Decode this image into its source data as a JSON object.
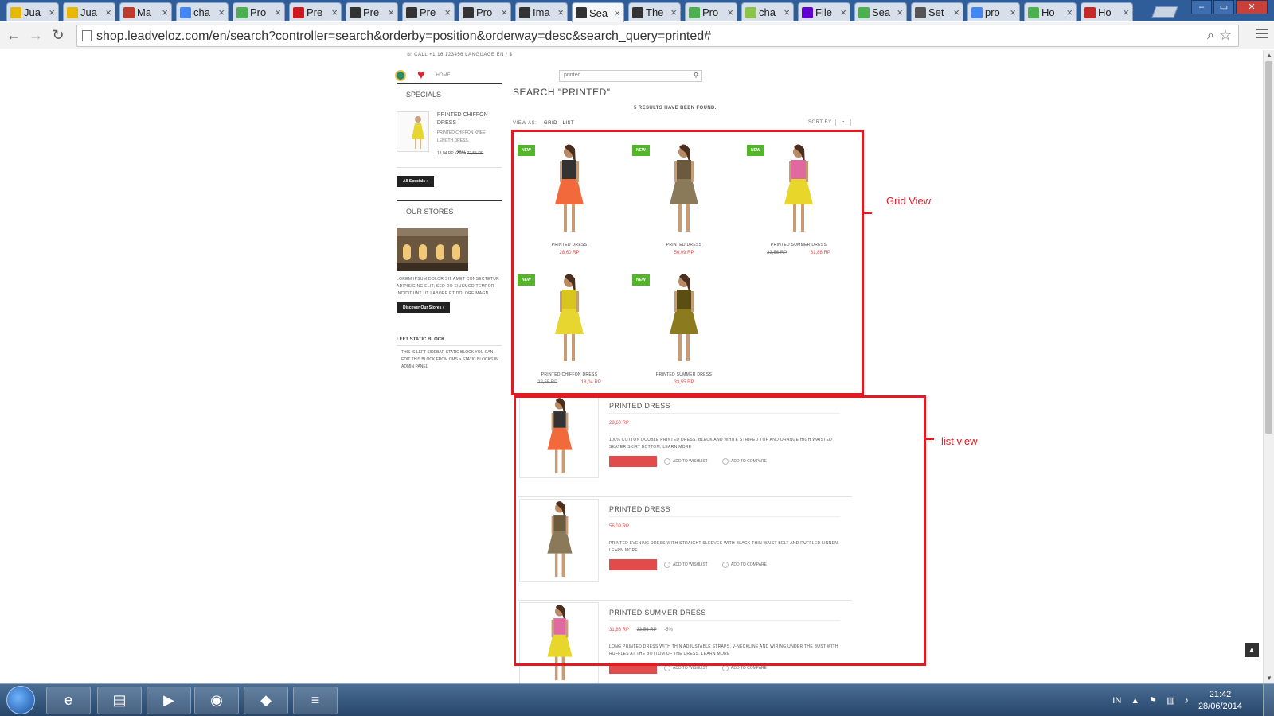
{
  "browser": {
    "tabs": [
      {
        "label": "Jua",
        "icon": "gmail-icon",
        "color": "#e8b800"
      },
      {
        "label": "Jua",
        "icon": "gmail-icon",
        "color": "#e8b800"
      },
      {
        "label": "Ma",
        "icon": "bars-icon",
        "color": "#c0392b"
      },
      {
        "label": "cha",
        "icon": "google-icon",
        "color": "#4285f4"
      },
      {
        "label": "Pro",
        "icon": "leaf-icon",
        "color": "#4caf50"
      },
      {
        "label": "Pre",
        "icon": "youtube-icon",
        "color": "#cc181e"
      },
      {
        "label": "Pre",
        "icon": "prestashop-icon",
        "color": "#333333"
      },
      {
        "label": "Pre",
        "icon": "prestashop-icon",
        "color": "#333333"
      },
      {
        "label": "Pro",
        "icon": "prestashop-icon",
        "color": "#333333"
      },
      {
        "label": "Ima",
        "icon": "prestashop-icon",
        "color": "#333333"
      },
      {
        "label": "Sea",
        "icon": "prestashop-icon",
        "color": "#333333",
        "active": true
      },
      {
        "label": "The",
        "icon": "prestashop-icon",
        "color": "#333333"
      },
      {
        "label": "Pro",
        "icon": "leaf-icon",
        "color": "#4caf50"
      },
      {
        "label": "cha",
        "icon": "cart-icon",
        "color": "#8bc34a"
      },
      {
        "label": "File",
        "icon": "yahoo-icon",
        "color": "#6001d2"
      },
      {
        "label": "Sea",
        "icon": "leaf-icon",
        "color": "#4caf50"
      },
      {
        "label": "Set",
        "icon": "wrench-icon",
        "color": "#555555"
      },
      {
        "label": "pro",
        "icon": "google-icon",
        "color": "#4285f4"
      },
      {
        "label": "Ho",
        "icon": "leaf-icon",
        "color": "#4caf50"
      },
      {
        "label": "Ho",
        "icon": "flag-icon",
        "color": "#c62828"
      }
    ],
    "tab_close": "×",
    "url": "shop.leadveloz.com/en/search?controller=search&orderby=position&orderway=desc&search_query=printed#"
  },
  "page": {
    "top_info": "☏ CALL +1 16 123456    LANGUAGE EN / $",
    "home_link": "HOME",
    "search": {
      "value": "printed"
    },
    "sidebar": {
      "specials_title": "SPECIALS",
      "special": {
        "name": "PRINTED CHIFFON DRESS",
        "desc": "PRINTED CHIFFON KNEE LENGTH DRESS.",
        "price": "18,04 RP",
        "discount": "-20%",
        "old_price": "22,55 RP"
      },
      "all_specials_button": "All Specials ›",
      "stores_title": "OUR STORES",
      "stores_text": "LOREM IPSUM DOLOR SIT AMET CONSECTETUR ADIPISICING ELIT, SED DO EIUSMOD TEMPOR INCIDIDUNT UT LABORE ET DOLORE MAGN",
      "discover_button": "Discover Our Stores ›",
      "left_static_title": "LEFT STATIC BLOCK",
      "left_static_text": "THIS IS LEFT SIDEBAR STATIC BLOCK YOU CAN EDIT THIS BLOCK FROM CMS > STATIC BLOCKS IN ADMIN PANEL"
    },
    "title": "SEARCH \"PRINTED\"",
    "results_count": "5 RESULTS HAVE BEEN FOUND.",
    "view_as": "VIEW AS:",
    "grid_label": "GRID",
    "list_label": "LIST",
    "sort_by": "SORT BY",
    "sort_value": "--",
    "new_badge": "NEW",
    "grid_products": [
      {
        "name": "PRINTED DRESS",
        "price": "28,60 RP",
        "old_price": "",
        "dress": "#f26a3b",
        "top": "#333333"
      },
      {
        "name": "PRINTED DRESS",
        "price": "56,09 RP",
        "old_price": "",
        "dress": "#8a7a5a",
        "top": "#6b5a3e"
      },
      {
        "name": "PRINTED SUMMER DRESS",
        "price": "31,88 RP",
        "old_price": "33,56 RP",
        "dress": "#e8d62a",
        "top": "#e06aa0"
      },
      {
        "name": "PRINTED CHIFFON DRESS",
        "price": "18,04 RP",
        "old_price": "22,55 RP",
        "dress": "#e8d630",
        "top": "#d9c520"
      },
      {
        "name": "PRINTED SUMMER DRESS",
        "price": "33,55 RP",
        "old_price": "",
        "dress": "#8b7a1e",
        "top": "#5a4e14"
      }
    ],
    "list_products": [
      {
        "name": "PRINTED DRESS",
        "price": "28,60 RP",
        "old_price": "",
        "discount": "",
        "desc": "100% COTTON DOUBLE PRINTED DRESS. BLACK AND WHITE STRIPED TOP AND ORANGE HIGH WAISTED SKATER SKIRT BOTTOM. LEARN MORE",
        "dress": "#f26a3b",
        "top": "#333333"
      },
      {
        "name": "PRINTED DRESS",
        "price": "56,09 RP",
        "old_price": "",
        "discount": "",
        "desc": "PRINTED EVENING DRESS WITH STRAIGHT SLEEVES WITH BLACK THIN WAIST BELT AND RUFFLED LINNEN. LEARN MORE",
        "dress": "#8a7a5a",
        "top": "#6b5a3e"
      },
      {
        "name": "PRINTED SUMMER DRESS",
        "price": "31,88 RP",
        "old_price": "33,56 RP",
        "discount": "-5%",
        "desc": "LONG PRINTED DRESS WITH THIN ADJUSTABLE STRAPS. V-NECKLINE AND WIRING UNDER THE BUST WITH RUFFLES AT THE BOTTOM OF THE DRESS. LEARN MORE",
        "dress": "#e8d62a",
        "top": "#e06aa0"
      }
    ],
    "add_to_wishlist": "ADD TO WISHLIST",
    "add_to_compare": "ADD TO COMPARE",
    "back_to_top": "▲"
  },
  "annotations": {
    "grid_label": "Grid View",
    "list_label": "list view",
    "color": "#e01b24"
  },
  "taskbar": {
    "apps": [
      {
        "name": "internet-explorer-icon",
        "glyph": "e"
      },
      {
        "name": "file-explorer-icon",
        "glyph": "▤"
      },
      {
        "name": "media-player-icon",
        "glyph": "▶"
      },
      {
        "name": "chrome-icon",
        "glyph": "◉"
      },
      {
        "name": "app-icon",
        "glyph": "◆"
      },
      {
        "name": "bluestacks-icon",
        "glyph": "≡"
      }
    ],
    "language": "IN",
    "time": "21:42",
    "date": "28/06/2014"
  }
}
